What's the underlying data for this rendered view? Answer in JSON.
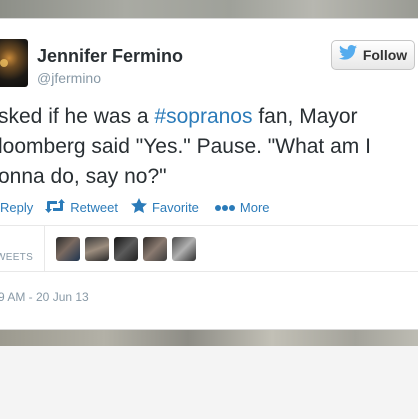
{
  "user": {
    "name": "Jennifer Fermino",
    "handle": "@jfermino",
    "follow_label": "Follow"
  },
  "tweet": {
    "line1_before": "sked if he was a ",
    "hashtag": "#sopranos",
    "line1_after": " fan, Mayor",
    "line2": "loomberg said \"Yes.\" Pause. \"What am I",
    "line3": "onna do, say no?\""
  },
  "actions": {
    "reply": "Reply",
    "retweet": "Retweet",
    "favorite": "Favorite",
    "more": "More"
  },
  "stats": {
    "retweets_label": "WEETS"
  },
  "timestamp": "9 AM - 20 Jun 13",
  "colors": {
    "link": "#2b7bb9",
    "text": "#292f33",
    "muted": "#8899a6",
    "twitter_bird": "#55acee"
  },
  "icons": [
    "twitter-bird-icon",
    "reply-icon",
    "retweet-icon",
    "star-icon",
    "more-dots-icon"
  ]
}
